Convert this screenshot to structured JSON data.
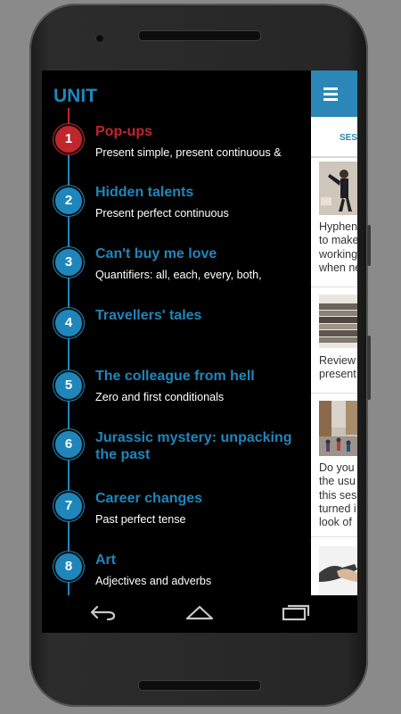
{
  "drawer": {
    "title": "UNIT",
    "units": [
      {
        "number": "1",
        "title": "Pop-ups",
        "subtitle": "Present simple, present continuous &",
        "active": true
      },
      {
        "number": "2",
        "title": "Hidden talents",
        "subtitle": "Present perfect continuous",
        "active": false
      },
      {
        "number": "3",
        "title": "Can't buy me love",
        "subtitle": "Quantifiers: all, each, every, both,",
        "active": false
      },
      {
        "number": "4",
        "title": "Travellers' tales",
        "subtitle": "",
        "active": false
      },
      {
        "number": "5",
        "title": "The colleague from hell",
        "subtitle": "Zero and first conditionals",
        "active": false
      },
      {
        "number": "6",
        "title": "Jurassic mystery: unpacking the past",
        "subtitle": "",
        "active": false
      },
      {
        "number": "7",
        "title": "Career changes",
        "subtitle": "Past perfect tense",
        "active": false
      },
      {
        "number": "8",
        "title": "Art",
        "subtitle": "Adjectives and adverbs",
        "active": false
      }
    ]
  },
  "background_app": {
    "tab_label": "SES",
    "cards": [
      {
        "lines": [
          "Hyphen",
          "to make",
          "working",
          "when ne"
        ]
      },
      {
        "lines": [
          "Review",
          "present"
        ]
      },
      {
        "lines": [
          "Do you",
          "the usu",
          "this ses",
          "turned i",
          "look of"
        ]
      }
    ]
  },
  "nav": {
    "back_icon": "back-icon",
    "home_icon": "home-icon",
    "recents_icon": "recents-icon"
  },
  "colors": {
    "accent": "#1f86bb",
    "active": "#c0262b"
  }
}
